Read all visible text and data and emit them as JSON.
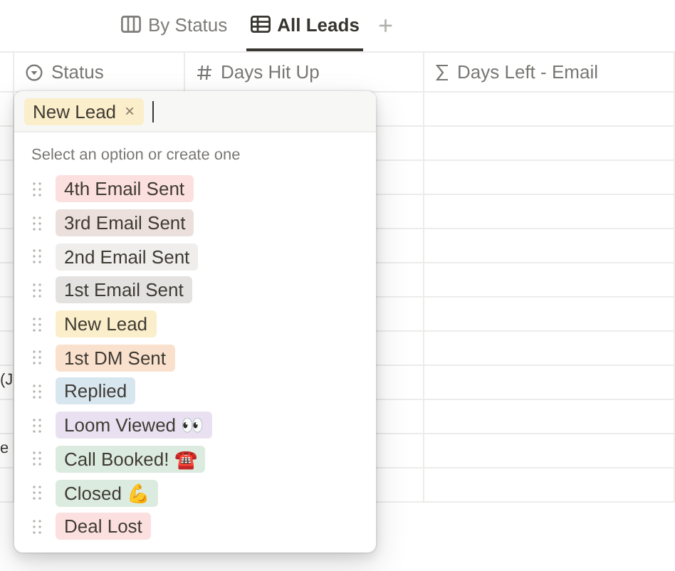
{
  "views": [
    {
      "label": "By Status",
      "kind": "board",
      "selected": false
    },
    {
      "label": "All Leads",
      "kind": "table",
      "selected": true
    }
  ],
  "add_view": "+",
  "columns": [
    {
      "label": "Status",
      "kind": "select"
    },
    {
      "label": "Days Hit Up",
      "kind": "number"
    },
    {
      "label": "Days Left - Email",
      "kind": "formula"
    }
  ],
  "rows": [
    {
      "cell": ""
    },
    {
      "cell": ""
    },
    {
      "cell": ""
    },
    {
      "cell": ""
    },
    {
      "cell": ""
    },
    {
      "cell": ""
    },
    {
      "cell": ""
    },
    {
      "cell": ""
    },
    {
      "cell": "(J"
    },
    {
      "cell": ""
    },
    {
      "cell": "e"
    },
    {
      "cell": ""
    }
  ],
  "popup": {
    "selected_tag": {
      "label": "New Lead",
      "color": "#fbeecb",
      "remove": "×"
    },
    "hint": "Select an option or create one",
    "options": [
      {
        "label": "4th Email Sent",
        "color": "#fbe0df"
      },
      {
        "label": "3rd Email Sent",
        "color": "#ece0dc"
      },
      {
        "label": "2nd Email Sent",
        "color": "#efeeec"
      },
      {
        "label": "1st Email Sent",
        "color": "#e3e2e0"
      },
      {
        "label": "New Lead",
        "color": "#fbeecb"
      },
      {
        "label": "1st DM Sent",
        "color": "#f9e1cd"
      },
      {
        "label": "Replied",
        "color": "#d8e6f0"
      },
      {
        "label": "Loom Viewed 👀",
        "color": "#e9e1f1"
      },
      {
        "label": "Call Booked! ☎️",
        "color": "#dcebdf"
      },
      {
        "label": "Closed 💪",
        "color": "#dcebdf"
      },
      {
        "label": "Deal Lost",
        "color": "#fbe0df"
      }
    ]
  }
}
